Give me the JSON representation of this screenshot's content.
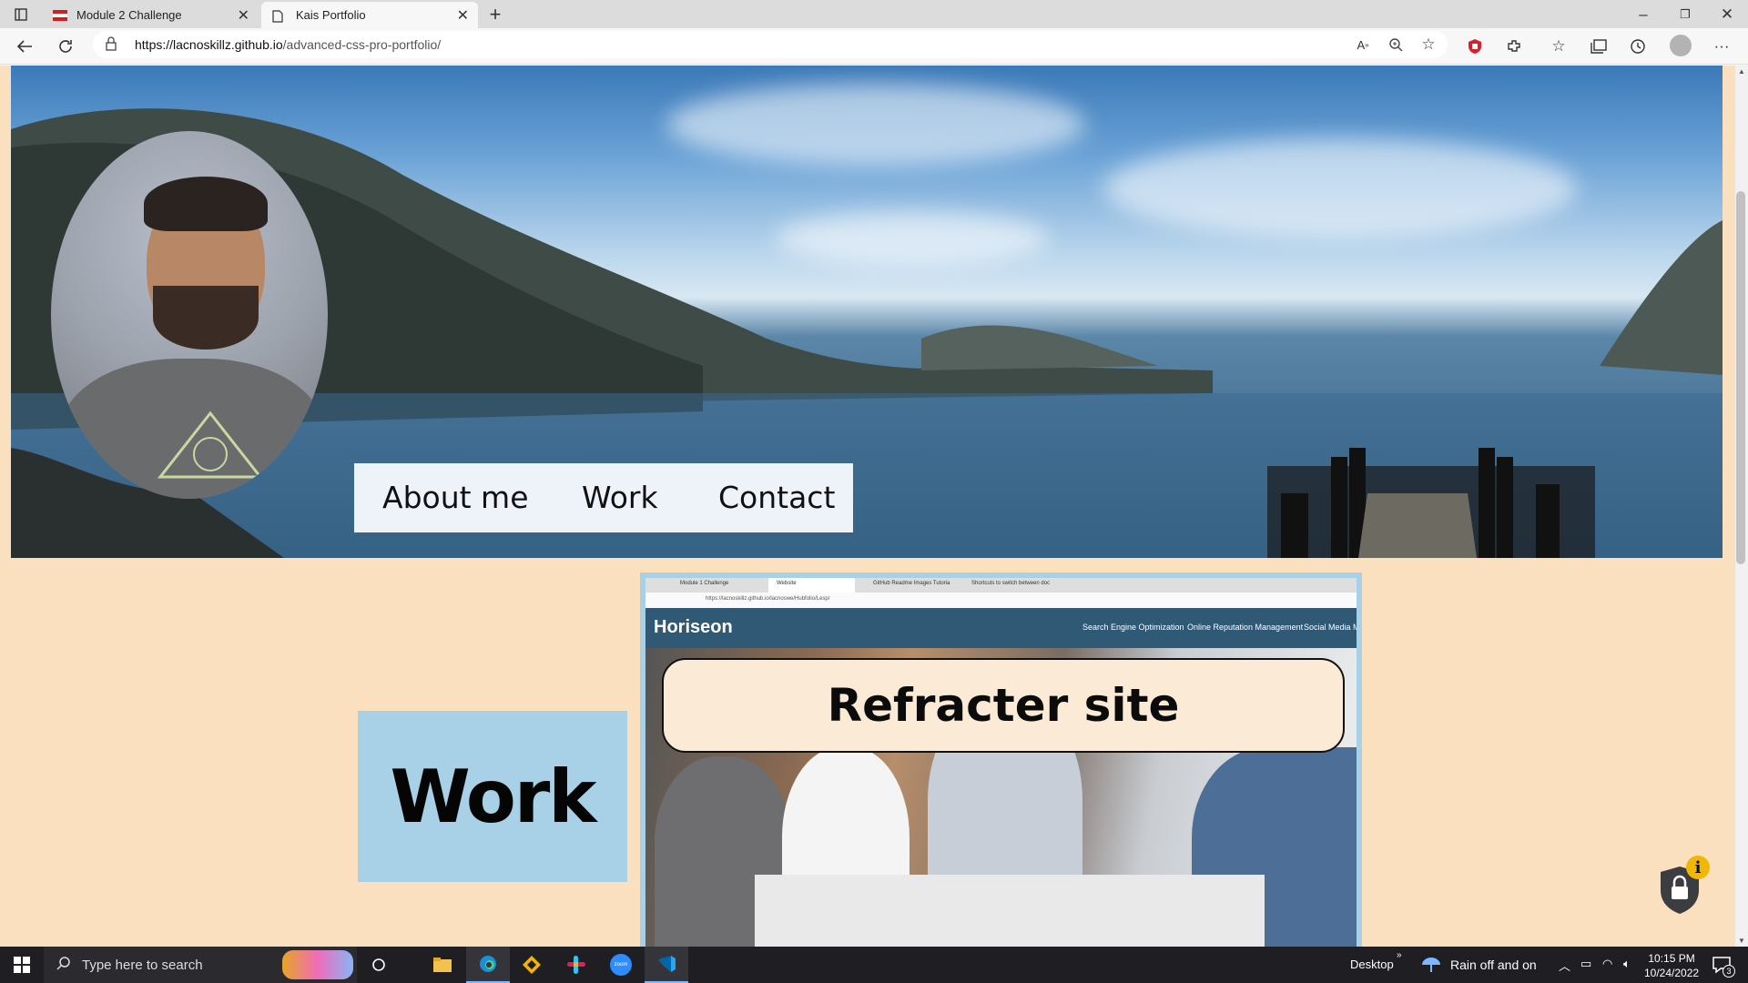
{
  "browser": {
    "tabs": [
      {
        "title": "Module 2 Challenge",
        "favicon": "usa-favicon",
        "active": false
      },
      {
        "title": "Kais Portfolio",
        "favicon": "page-icon",
        "active": true
      }
    ],
    "url": {
      "scheme_host": "https://lacnoskillz.github.io",
      "path": "/advanced-css-pro-portfolio/"
    }
  },
  "page": {
    "nav": {
      "about": "About me",
      "work": "Work",
      "contact": "Contact"
    },
    "work_heading": "Work",
    "project": {
      "title": "Refracter site",
      "screenshot": {
        "brand": "Horiseon",
        "menu": [
          "Search Engine Optimization",
          "Online Reputation Management",
          "Social Media Ma"
        ],
        "tabs": [
          "Module 1 Challenge",
          "Website",
          "GitHub Readme Images Tutoria",
          "Shortcuts to switch between doc"
        ],
        "url": "https://lacnoskillz.github.io/lacnoswe/Hubfolio/Lesp/"
      }
    }
  },
  "taskbar": {
    "search_placeholder": "Type here to search",
    "desktop_label": "Desktop",
    "weather": "Rain off and on",
    "time": "10:15 PM",
    "date": "10/24/2022",
    "notification_count": "3"
  },
  "colors": {
    "page_bg": "#fbe0c0",
    "work_heading_bg": "#a8d0e6",
    "nav_bg": "#eef3fa",
    "card_header": "#2f5975"
  }
}
